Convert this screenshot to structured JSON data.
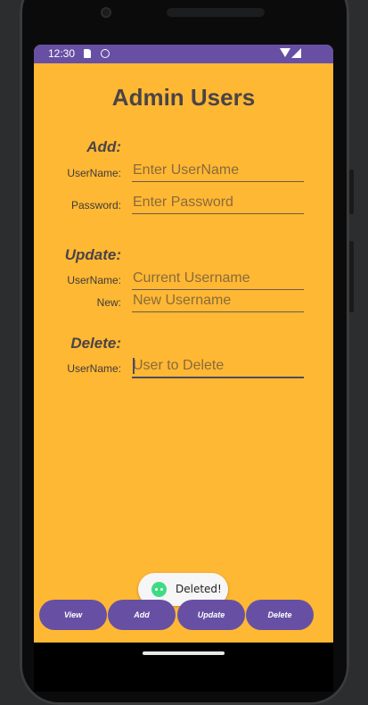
{
  "status_bar": {
    "time": "12:30",
    "icons": [
      "sim-card-icon",
      "app-notification-icon",
      "wifi-icon",
      "signal-icon"
    ],
    "color": "#6750a4"
  },
  "page": {
    "title": "Admin Users",
    "background": "#ffb833"
  },
  "add": {
    "heading": "Add:",
    "username_label": "UserName:",
    "username_placeholder": "Enter UserName",
    "username_value": "",
    "password_label": "Password:",
    "password_placeholder": "Enter Password",
    "password_value": ""
  },
  "update": {
    "heading": "Update:",
    "username_label": "UserName:",
    "username_placeholder": "Current Username",
    "username_value": "",
    "new_label": "New:",
    "new_placeholder": "New Username",
    "new_value": ""
  },
  "delete": {
    "heading": "Delete:",
    "username_label": "UserName:",
    "username_placeholder": "User to Delete",
    "username_value": ""
  },
  "toast": {
    "icon": "android-icon",
    "message": "Deleted!"
  },
  "buttons": {
    "view": "View",
    "add": "Add",
    "update": "Update",
    "delete": "Delete",
    "color": "#6750a4"
  }
}
